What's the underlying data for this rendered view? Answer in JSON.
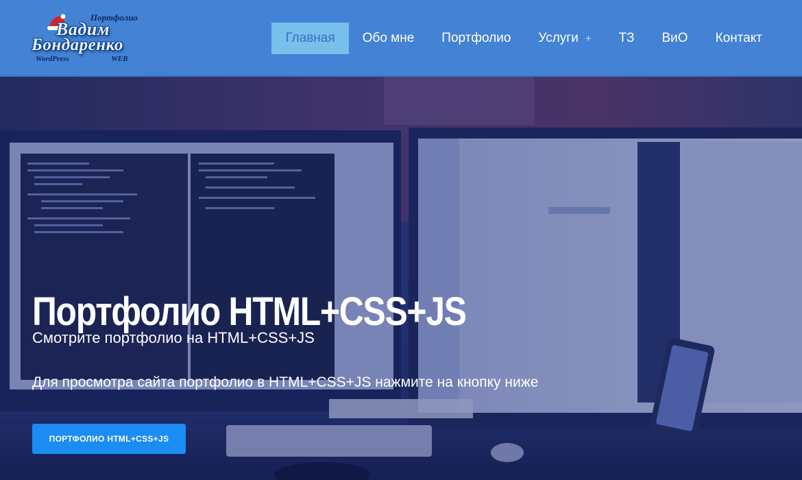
{
  "logo": {
    "subtitle": "Портфолио",
    "name_line1": "Вадим",
    "name_line2": "Бондаренко",
    "tag_left": "WordPress",
    "tag_right": "WEB"
  },
  "nav": {
    "items": [
      {
        "label": "Главная",
        "active": true
      },
      {
        "label": "Обо мне"
      },
      {
        "label": "Портфолио"
      },
      {
        "label": "Услуги",
        "has_submenu": true,
        "submenu_icon": "+"
      },
      {
        "label": "ТЗ"
      },
      {
        "label": "ВиО"
      },
      {
        "label": "Контакт"
      }
    ]
  },
  "hero": {
    "title": "Портфолио HTML+CSS+JS",
    "subtitle": "Смотрите портфолио на HTML+CSS+JS",
    "description": "Для просмотра сайта портфолио в HTML+CSS+JS нажмите на кнопку ниже",
    "button_label": "ПОРТФОЛИО HTML+CSS+JS"
  },
  "colors": {
    "header_bg": "#4382d4",
    "nav_active_bg": "#78c0ec",
    "button_bg": "#1b8cf2",
    "hero_overlay": "#18286e"
  }
}
